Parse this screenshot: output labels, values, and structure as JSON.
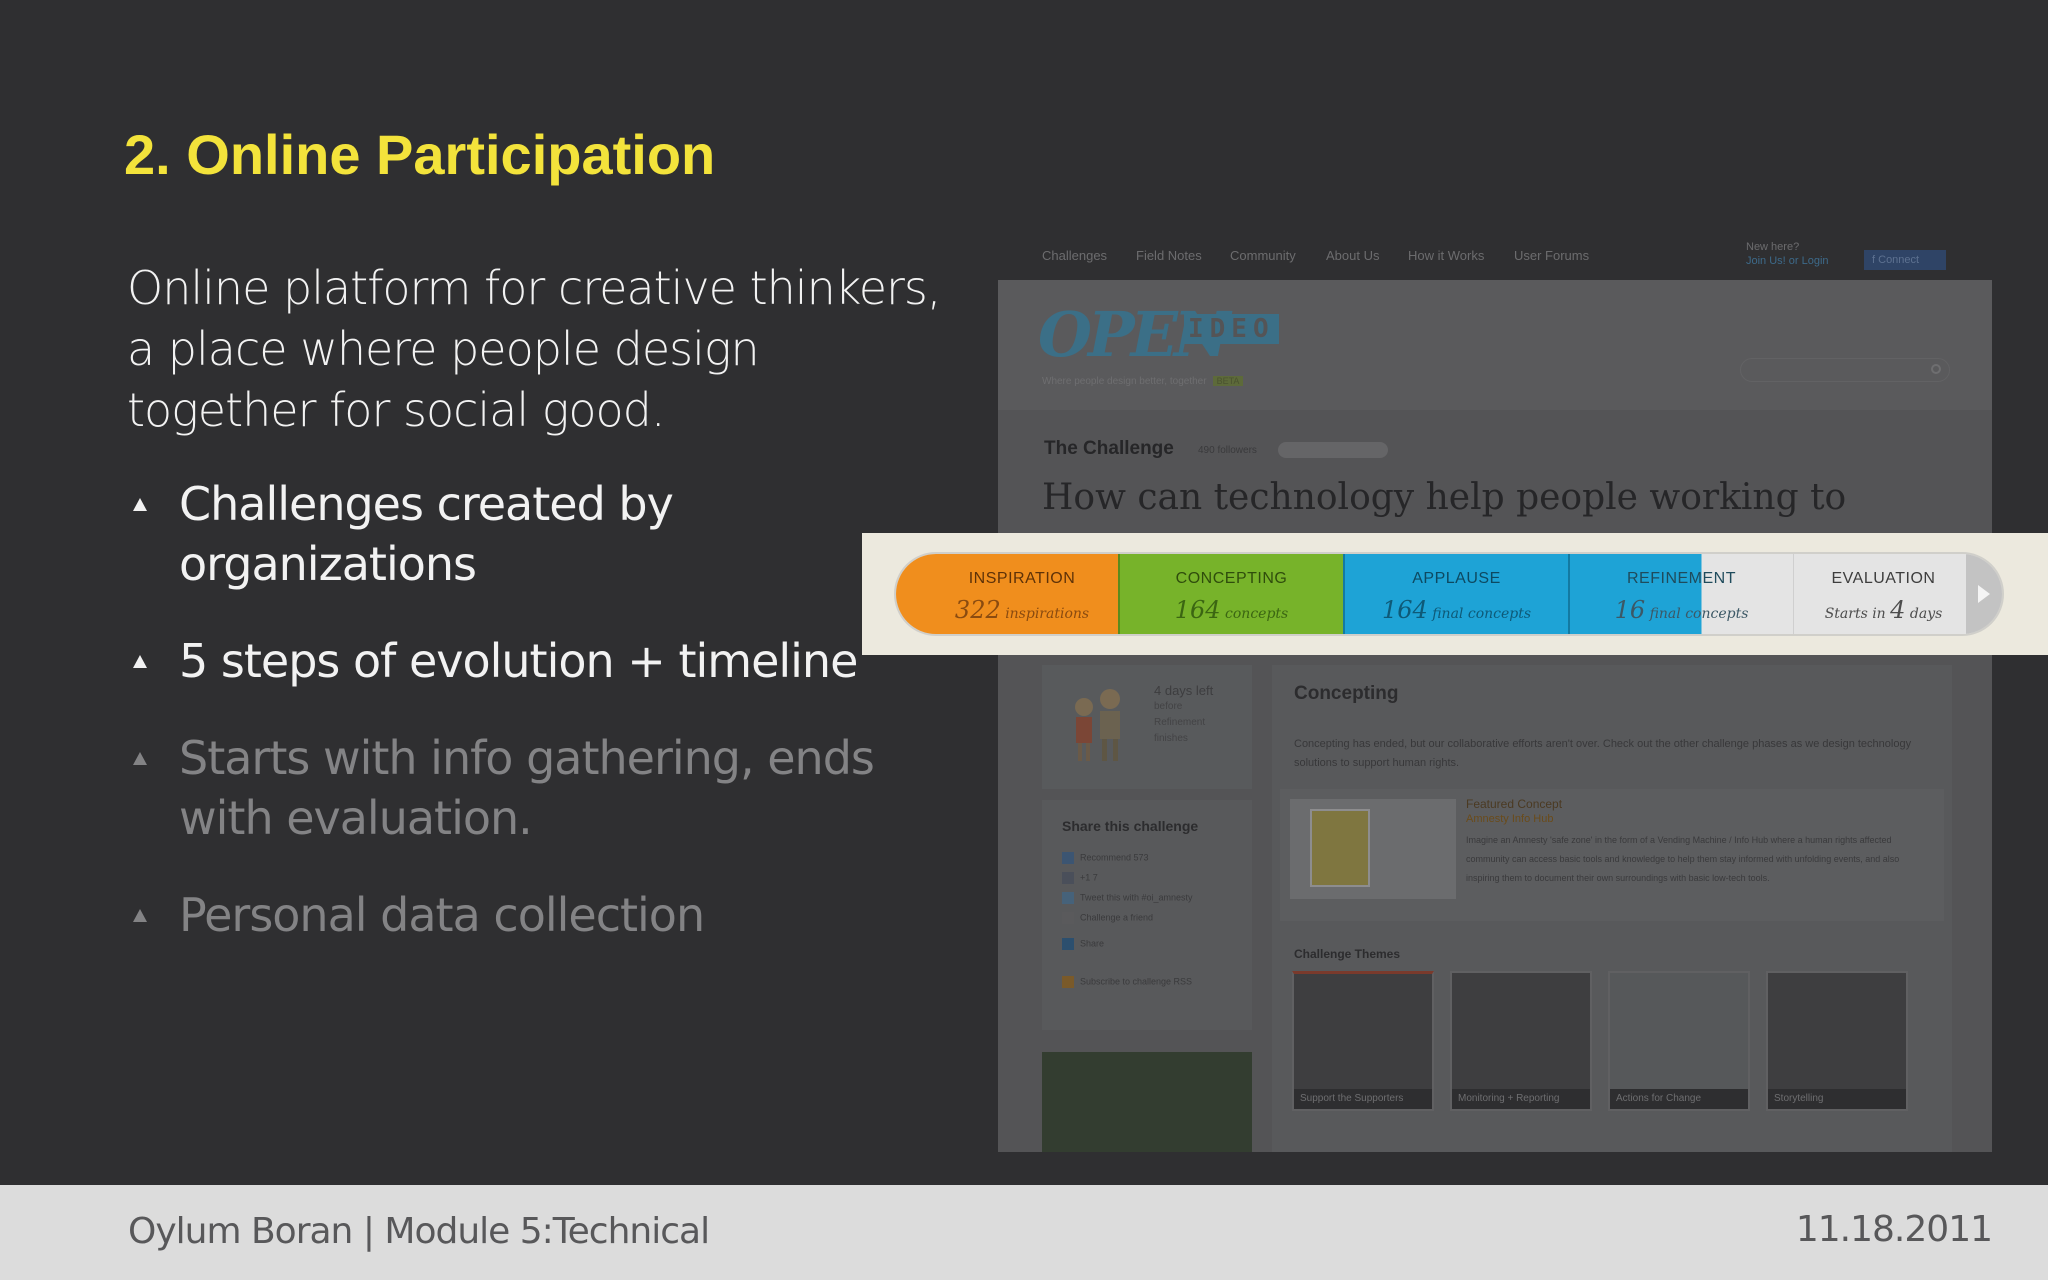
{
  "slide": {
    "title": "2. Online Participation",
    "intro": "Online platform for creative thinkers, a place where people design together for social good.",
    "bullets": [
      {
        "text": "Challenges created by organizations",
        "state": "active"
      },
      {
        "text": "5 steps of evolution + timeline",
        "state": "active"
      },
      {
        "text": "Starts with info gathering, ends with evaluation.",
        "state": "dim"
      },
      {
        "text": "Personal data collection",
        "state": "dim"
      }
    ]
  },
  "screenshot": {
    "nav": [
      "Challenges",
      "Field Notes",
      "Community",
      "About Us",
      "How it Works",
      "User Forums"
    ],
    "new_here": "New here?",
    "join_login": "Join Us! or Login",
    "connect": "Connect",
    "logo_open": "OPEN",
    "logo_ideo": "IDEO",
    "tagline": "Where people design better, together",
    "tagline_badge": "BETA",
    "challenge_label": "The Challenge",
    "followers": "490 followers",
    "question": "How can technology help people working to uphold human rights in the face of unlawful detention?",
    "days_left": "4 days left",
    "days_left_sub": [
      "before",
      "Refinement",
      "finishes"
    ],
    "share_title": "Share this challenge",
    "share_rows": [
      "Recommend   573",
      "+1   7",
      "Tweet this with #oi_amnesty",
      "Challenge a friend",
      "Share",
      "Subscribe to challenge RSS"
    ],
    "main_title": "Concepting",
    "main_text": "Concepting has ended, but our collaborative efforts aren't over. Check out the other challenge phases as we design technology solutions to support human rights.",
    "featured_title": "Featured Concept",
    "featured_name": "Amnesty Info Hub",
    "featured_body": "Imagine an Amnesty 'safe zone' in the form of a Vending Machine / Info Hub where a human rights affected community can access basic tools and knowledge to help them stay informed with unfolding events, and also inspiring them to document their own surroundings with basic low-tech tools.",
    "themes_title": "Challenge Themes",
    "themes": [
      "Support the Supporters",
      "Monitoring + Reporting",
      "Actions for Change",
      "Storytelling"
    ]
  },
  "timeline": {
    "stages": [
      {
        "label": "INSPIRATION",
        "num": "322",
        "unit": "inspirations"
      },
      {
        "label": "CONCEPTING",
        "num": "164",
        "unit": "concepts"
      },
      {
        "label": "APPLAUSE",
        "num": "164",
        "unit": "final concepts"
      },
      {
        "label": "REFINEMENT",
        "num": "16",
        "unit": "final concepts"
      },
      {
        "label": "EVALUATION",
        "prefix": "Starts in",
        "num": "4",
        "unit": "days"
      }
    ],
    "refinement_progress": 0.59
  },
  "footer": {
    "left": "Oylum Boran | Module 5:Technical",
    "right": "11.18.2011"
  }
}
